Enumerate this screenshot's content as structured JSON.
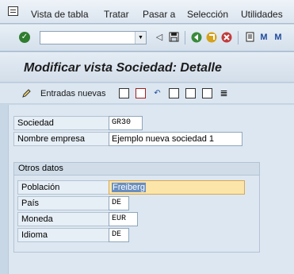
{
  "menubar": {
    "icon": "menu-window-icon",
    "items": [
      "Vista de tabla",
      "Tratar",
      "Pasar a",
      "Selección",
      "Utilidades"
    ]
  },
  "toolbar": {
    "command_field": "",
    "icons": [
      "enter-check-icon",
      "back-icon",
      "save-icon",
      "navigate-back-icon",
      "exit-icon",
      "cancel-icon",
      "print-icon",
      "find-icon",
      "find-next-icon"
    ]
  },
  "title": "Modificar vista Sociedad: Detalle",
  "app_toolbar": {
    "new_entries_label": "Entradas nuevas",
    "icons": [
      "copy-icon",
      "delete-icon",
      "undo-icon",
      "prev-entry-icon",
      "next-entry-icon",
      "select-all-icon",
      "details-icon"
    ]
  },
  "form": {
    "sociedad": {
      "label": "Sociedad",
      "value": "GR30"
    },
    "nombre": {
      "label": "Nombre empresa",
      "value": "Ejemplo nueva sociedad 1"
    },
    "group": {
      "title": "Otros datos",
      "poblacion": {
        "label": "Población",
        "value": "Freiberg"
      },
      "pais": {
        "label": "País",
        "value": "DE"
      },
      "moneda": {
        "label": "Moneda",
        "value": "EUR"
      },
      "idioma": {
        "label": "Idioma",
        "value": "DE"
      }
    }
  },
  "colors": {
    "background": "#c8d7e6",
    "highlight_field": "#fce5a8",
    "selection": "#6a8fbf"
  }
}
